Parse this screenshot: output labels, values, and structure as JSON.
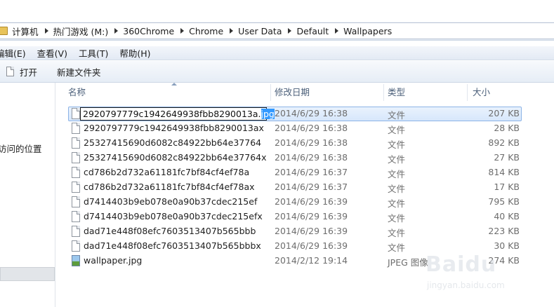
{
  "breadcrumb": [
    "计算机",
    "热门游戏 (M:)",
    "360Chrome",
    "Chrome",
    "User Data",
    "Default",
    "Wallpapers"
  ],
  "menu": [
    "编辑(E)",
    "查看(V)",
    "工具(T)",
    "帮助(H)"
  ],
  "toolbar": {
    "open_label": "打开",
    "new_folder_label": "新建文件夹"
  },
  "sidebar": {
    "recent_label": "访问的位置"
  },
  "columns": {
    "name": "名称",
    "date": "修改日期",
    "type": "类型",
    "size": "大小"
  },
  "rename": {
    "base": "2920797779c1942649938fbb8290013a.",
    "ext": "jpg"
  },
  "files": [
    {
      "name": "2920797779c1942649938fbb8290013a.jpg",
      "date": "2014/6/29 16:38",
      "type": "文件",
      "size": "207 KB",
      "icon": "file-icon",
      "selected": true
    },
    {
      "name": "2920797779c1942649938fbb8290013ax",
      "date": "2014/6/29 16:38",
      "type": "文件",
      "size": "28 KB",
      "icon": "file-icon"
    },
    {
      "name": "25327415690d6082c84922bb64e37764",
      "date": "2014/6/29 16:38",
      "type": "文件",
      "size": "892 KB",
      "icon": "file-icon"
    },
    {
      "name": "25327415690d6082c84922bb64e37764x",
      "date": "2014/6/29 16:38",
      "type": "文件",
      "size": "27 KB",
      "icon": "file-icon"
    },
    {
      "name": "cd786b2d732a61181fc7bf84cf4ef78a",
      "date": "2014/6/29 16:37",
      "type": "文件",
      "size": "814 KB",
      "icon": "file-icon"
    },
    {
      "name": "cd786b2d732a61181fc7bf84cf4ef78ax",
      "date": "2014/6/29 16:37",
      "type": "文件",
      "size": "17 KB",
      "icon": "file-icon"
    },
    {
      "name": "d7414403b9eb078e0a90b37cdec215ef",
      "date": "2014/6/29 16:39",
      "type": "文件",
      "size": "795 KB",
      "icon": "file-icon"
    },
    {
      "name": "d7414403b9eb078e0a90b37cdec215efx",
      "date": "2014/6/29 16:39",
      "type": "文件",
      "size": "40 KB",
      "icon": "file-icon"
    },
    {
      "name": "dad71e448f08efc7603513407b565bbb",
      "date": "2014/6/29 16:39",
      "type": "文件",
      "size": "223 KB",
      "icon": "file-icon"
    },
    {
      "name": "dad71e448f08efc7603513407b565bbbx",
      "date": "2014/6/29 16:39",
      "type": "文件",
      "size": "30 KB",
      "icon": "file-icon"
    },
    {
      "name": "wallpaper.jpg",
      "date": "2014/2/12 19:14",
      "type": "JPEG 图像",
      "size": "274 KB",
      "icon": "image-file-icon"
    }
  ],
  "watermark": {
    "logo": "Baidu",
    "sub": "jingyan.baidu.com"
  }
}
